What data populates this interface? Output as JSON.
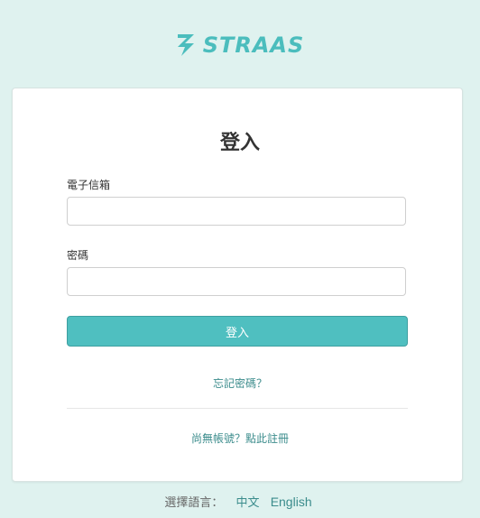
{
  "brand": {
    "logo_text": "STRAAS",
    "accent_color": "#4fbfc0"
  },
  "login": {
    "title": "登入",
    "email_label": "電子信箱",
    "email_value": "",
    "email_placeholder": "",
    "password_label": "密碼",
    "password_value": "",
    "password_placeholder": "",
    "submit_label": "登入",
    "forgot_password": "忘記密碼？",
    "signup_prompt": "尚無帳號？點此註冊"
  },
  "language": {
    "label": "選擇語言：",
    "options": [
      "中文",
      "English"
    ]
  }
}
